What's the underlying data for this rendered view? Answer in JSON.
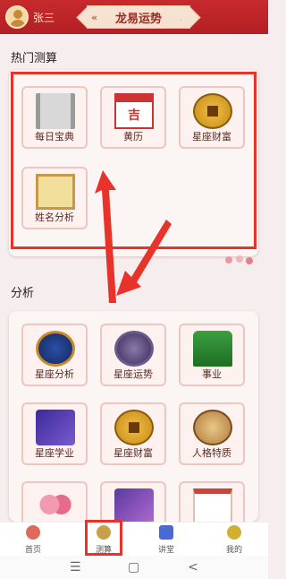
{
  "header": {
    "username": "张三",
    "title": "龙易运势"
  },
  "sections": {
    "hot": {
      "title": "热门测算",
      "items": [
        {
          "label": "每日宝典",
          "icon": "scroll-icon"
        },
        {
          "label": "黄历",
          "icon": "calendar-icon",
          "glyph": "吉"
        },
        {
          "label": "星座财富",
          "icon": "coin-icon"
        },
        {
          "label": "姓名分析",
          "icon": "book-icon"
        }
      ]
    },
    "analysis": {
      "title": "分析",
      "items": [
        {
          "label": "星座分析",
          "icon": "zodiac-wheel-icon"
        },
        {
          "label": "星座运势",
          "icon": "fortune-dial-icon"
        },
        {
          "label": "事业",
          "icon": "official-hat-icon"
        },
        {
          "label": "星座学业",
          "icon": "study-icon"
        },
        {
          "label": "星座财富",
          "icon": "coin-icon"
        },
        {
          "label": "人格特质",
          "icon": "vitruvian-icon"
        },
        {
          "label": "",
          "icon": "hearts-icon"
        },
        {
          "label": "",
          "icon": "purple-card-icon"
        },
        {
          "label": "",
          "icon": "paper-icon"
        }
      ]
    }
  },
  "bottom_nav": [
    {
      "label": "首页",
      "icon": "home-icon",
      "color": "#e06a5a"
    },
    {
      "label": "测算",
      "icon": "divination-icon",
      "color": "#c9a04a"
    },
    {
      "label": "讲堂",
      "icon": "lecture-icon",
      "color": "#4a6ad0"
    },
    {
      "label": "我的",
      "icon": "profile-icon",
      "color": "#d0b030"
    }
  ],
  "system_nav": {
    "menu": "☰",
    "home": "▢",
    "back": "<"
  },
  "colors": {
    "header": "#c62a2d",
    "highlight": "#e8332b"
  }
}
